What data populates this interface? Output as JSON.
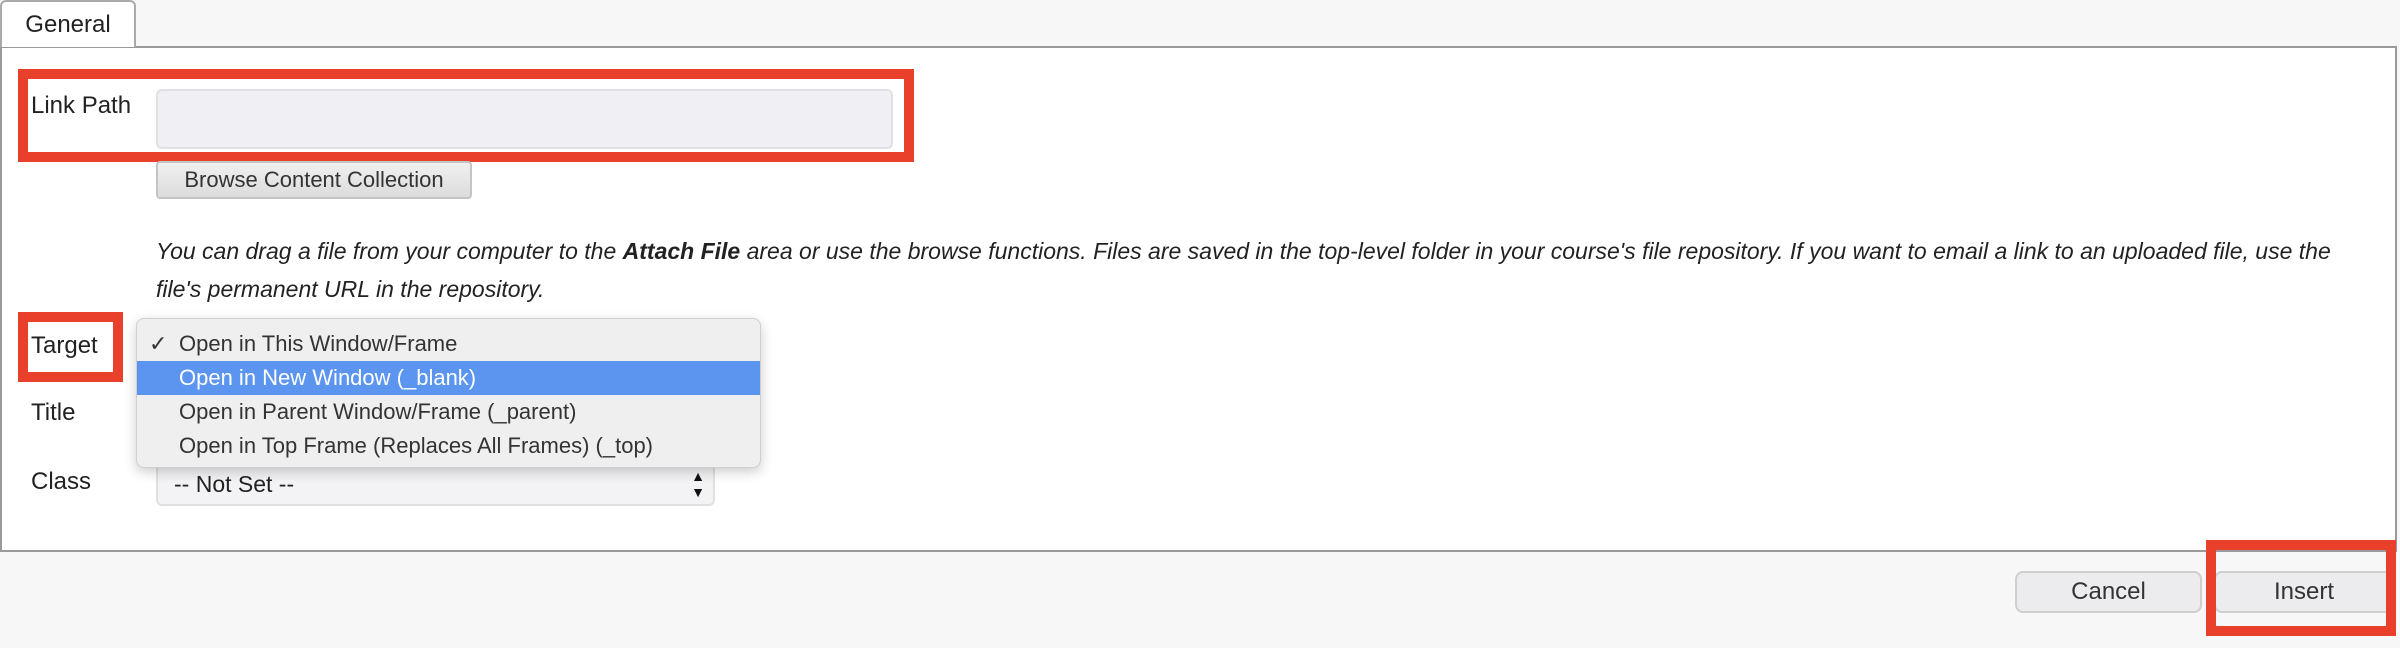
{
  "tabs": [
    {
      "label": "General",
      "active": true
    }
  ],
  "form": {
    "link_path": {
      "label": "Link Path",
      "value": "",
      "placeholder": ""
    },
    "browse_button": "Browse Content Collection",
    "help_text_parts": [
      "You can drag a file from your computer to the ",
      "Attach File",
      " area or use the browse functions. Files are saved in the top-level folder in your course's file repository. If you want to email a link to an uploaded file, use the file's permanent URL in the repository."
    ],
    "target": {
      "label": "Target",
      "options": [
        {
          "label": "Open in This Window/Frame",
          "checked": true
        },
        {
          "label": "Open in New Window (_blank)",
          "highlighted": true
        },
        {
          "label": "Open in Parent Window/Frame (_parent)"
        },
        {
          "label": "Open in Top Frame (Replaces All Frames) (_top)"
        }
      ],
      "check_glyph": "✓"
    },
    "title": {
      "label": "Title"
    },
    "class": {
      "label": "Class",
      "value": "-- Not Set --"
    }
  },
  "footer": {
    "cancel": "Cancel",
    "insert": "Insert"
  },
  "colors": {
    "highlight_box": "#e8402a",
    "selected_option": "#5b95ef"
  }
}
